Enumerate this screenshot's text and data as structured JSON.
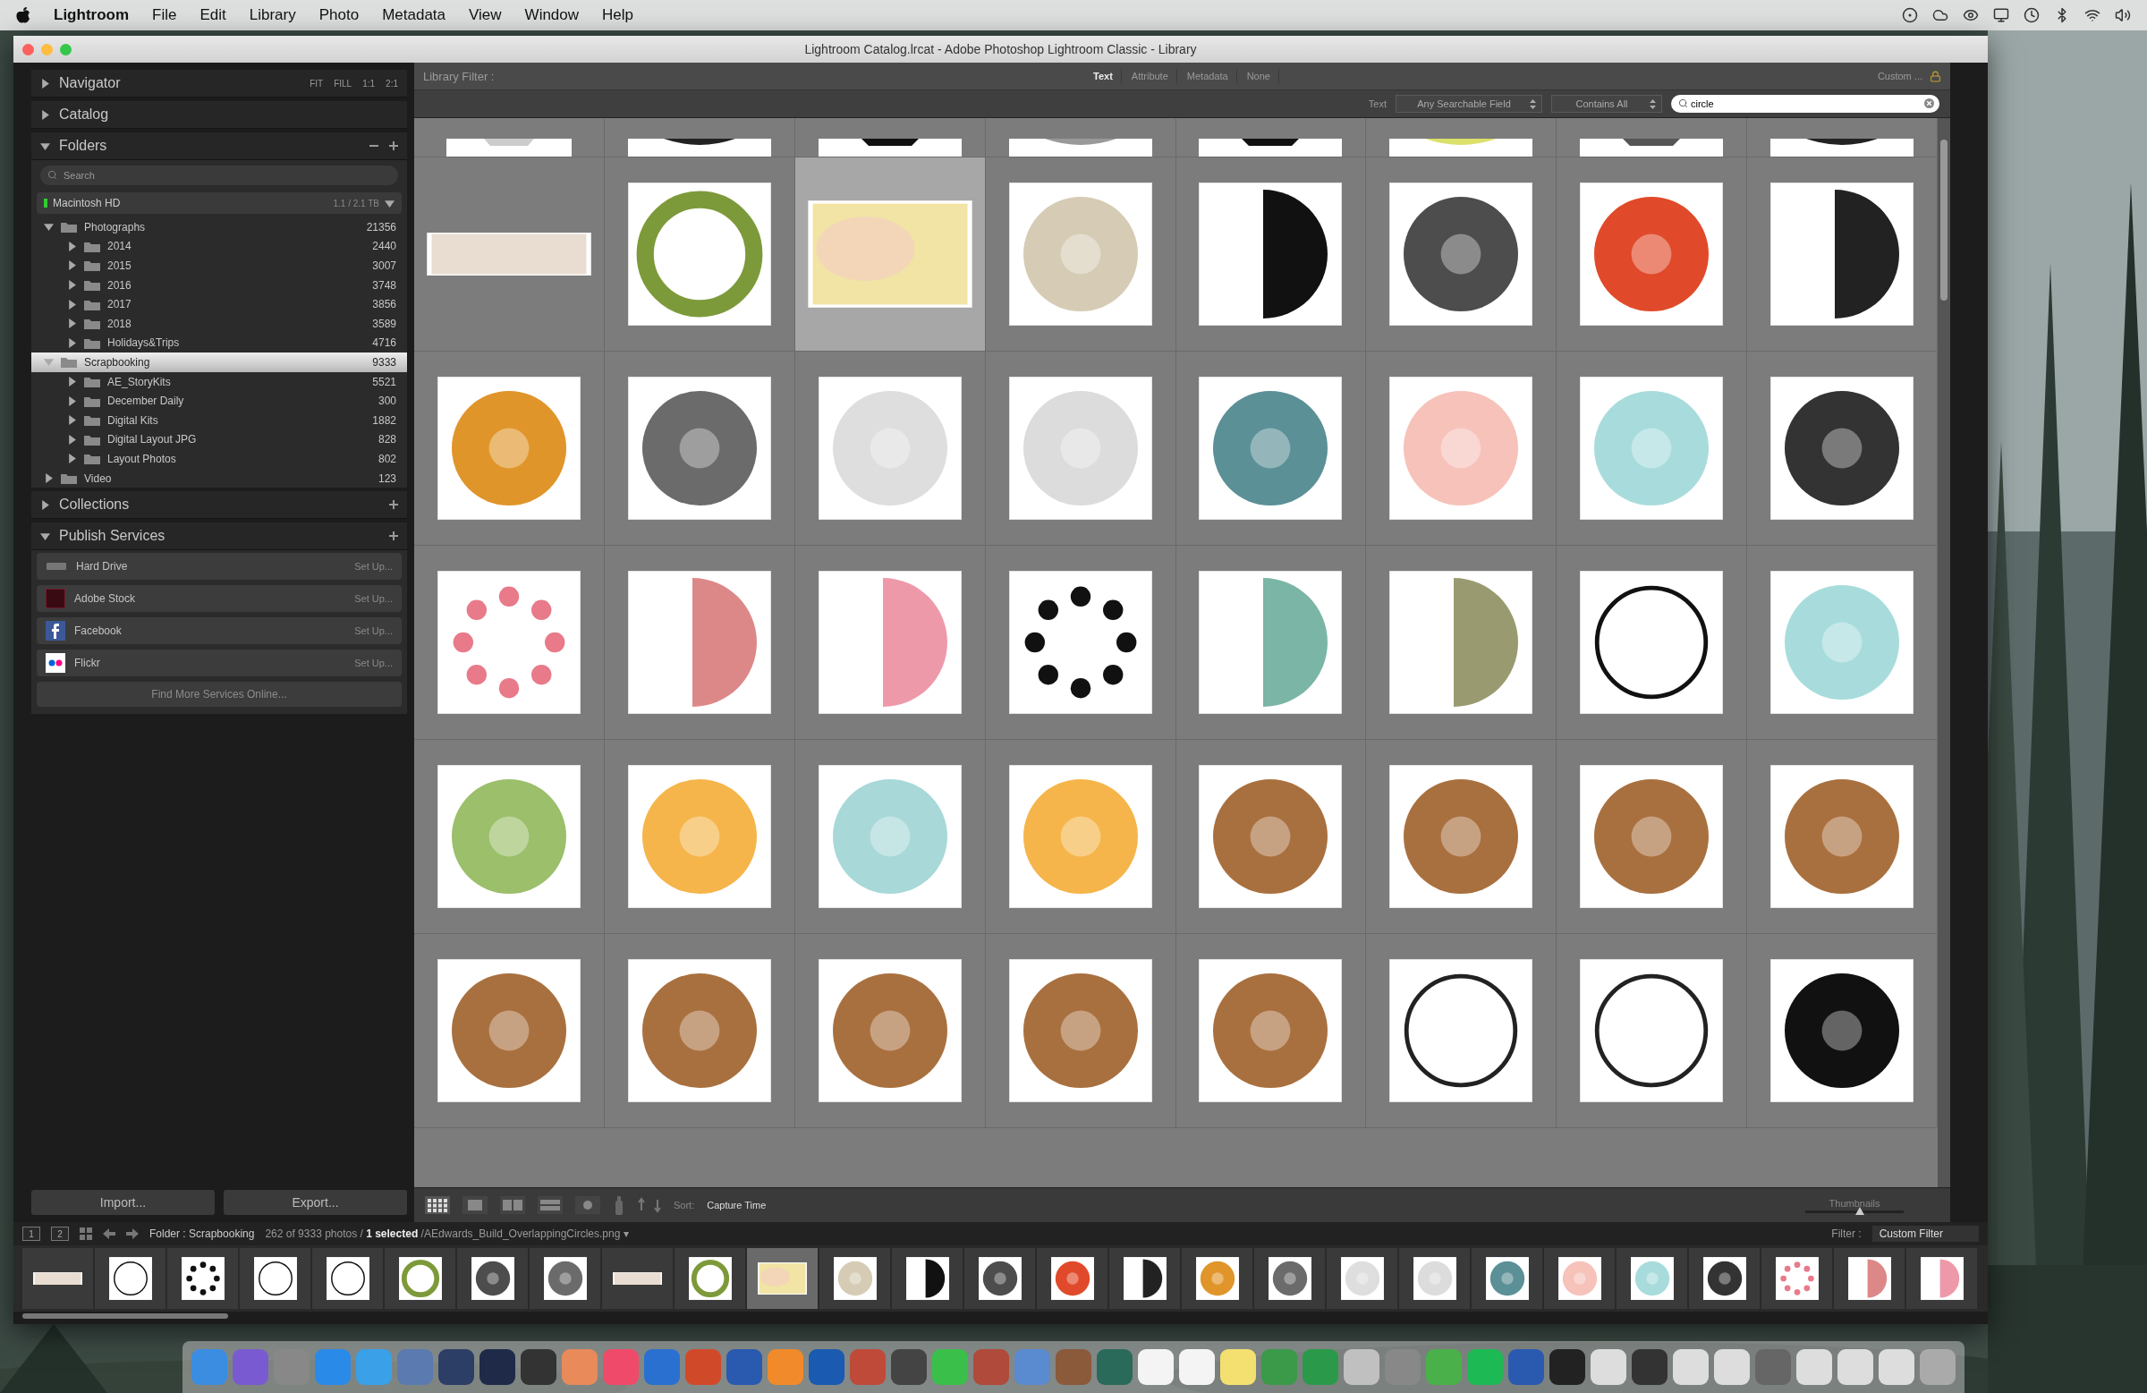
{
  "menu_bar": {
    "app": "Lightroom",
    "menus": [
      "File",
      "Edit",
      "Library",
      "Photo",
      "Metadata",
      "View",
      "Window",
      "Help"
    ]
  },
  "window": {
    "title": "Lightroom Catalog.lrcat - Adobe Photoshop Lightroom Classic - Library"
  },
  "left_panel": {
    "navigator": {
      "title": "Navigator",
      "expanded": false,
      "zoom_options": [
        "FIT",
        "FILL",
        "1:1",
        "2:1"
      ]
    },
    "catalog": {
      "title": "Catalog",
      "expanded": false
    },
    "folders": {
      "title": "Folders",
      "expanded": true,
      "search_placeholder": "Search",
      "volume": {
        "name": "Macintosh HD",
        "space": "1.1 / 2.1 TB"
      },
      "tree": [
        {
          "name": "Photographs",
          "count": "21356",
          "expanded": true,
          "selected": false,
          "children": [
            {
              "name": "2014",
              "count": "2440",
              "expanded": false,
              "selected": false
            },
            {
              "name": "2015",
              "count": "3007",
              "expanded": false,
              "selected": false
            },
            {
              "name": "2016",
              "count": "3748",
              "expanded": false,
              "selected": false
            },
            {
              "name": "2017",
              "count": "3856",
              "expanded": false,
              "selected": false
            },
            {
              "name": "2018",
              "count": "3589",
              "expanded": false,
              "selected": false
            },
            {
              "name": "Holidays&Trips",
              "count": "4716",
              "expanded": false,
              "selected": false
            }
          ]
        },
        {
          "name": "Scrapbooking",
          "count": "9333",
          "expanded": true,
          "selected": true,
          "children": [
            {
              "name": "AE_StoryKits",
              "count": "5521",
              "expanded": false,
              "selected": false
            },
            {
              "name": "December Daily",
              "count": "300",
              "expanded": false,
              "selected": false
            },
            {
              "name": "Digital Kits",
              "count": "1882",
              "expanded": false,
              "selected": false
            },
            {
              "name": "Digital Layout JPG",
              "count": "828",
              "expanded": false,
              "selected": false
            },
            {
              "name": "Layout Photos",
              "count": "802",
              "expanded": false,
              "selected": false
            }
          ]
        },
        {
          "name": "Video",
          "count": "123",
          "expanded": false,
          "selected": false
        }
      ]
    },
    "collections": {
      "title": "Collections",
      "expanded": false
    },
    "publish_services": {
      "title": "Publish Services",
      "expanded": true,
      "services": [
        {
          "kind": "drive",
          "name": "Hard Drive",
          "action": "Set Up..."
        },
        {
          "kind": "stock",
          "name": "Adobe Stock",
          "action": "Set Up..."
        },
        {
          "kind": "facebook",
          "name": "Facebook",
          "action": "Set Up..."
        },
        {
          "kind": "flickr",
          "name": "Flickr",
          "action": "Set Up..."
        }
      ],
      "find_more": "Find More Services Online..."
    },
    "buttons": [
      "Import...",
      "Export..."
    ]
  },
  "library_filter": {
    "label": "Library Filter :",
    "tabs": [
      {
        "label": "Text",
        "selected": true
      },
      {
        "label": "Attribute",
        "selected": false
      },
      {
        "label": "Metadata",
        "selected": false
      },
      {
        "label": "None",
        "selected": false
      }
    ],
    "preset": "Custom ...",
    "locked": true,
    "text_label": "Text",
    "field": "Any Searchable Field",
    "rule": "Contains All",
    "search": "circle"
  },
  "grid": {
    "cut_row": [
      {
        "selected": false
      },
      {
        "selected": false
      },
      {
        "selected": false
      },
      {
        "selected": false
      },
      {
        "selected": false
      },
      {
        "selected": false
      },
      {
        "selected": false
      },
      {
        "selected": false
      }
    ],
    "rows": [
      [
        {
          "selected": false
        },
        {
          "selected": false
        },
        {
          "selected": true
        },
        {
          "selected": false
        },
        {
          "selected": false
        },
        {
          "selected": false
        },
        {
          "selected": false
        },
        {
          "selected": false
        }
      ],
      [
        {
          "selected": false
        },
        {
          "selected": false
        },
        {
          "selected": false
        },
        {
          "selected": false
        },
        {
          "selected": false
        },
        {
          "selected": false
        },
        {
          "selected": false
        },
        {
          "selected": false
        }
      ],
      [
        {
          "selected": false
        },
        {
          "selected": false
        },
        {
          "selected": false
        },
        {
          "selected": false
        },
        {
          "selected": false
        },
        {
          "selected": false
        },
        {
          "selected": false
        },
        {
          "selected": false
        }
      ],
      [
        {
          "selected": false
        },
        {
          "selected": false
        },
        {
          "selected": false
        },
        {
          "selected": false
        },
        {
          "selected": false
        },
        {
          "selected": false
        },
        {
          "selected": false
        },
        {
          "selected": false
        }
      ],
      [
        {
          "selected": false
        },
        {
          "selected": false
        },
        {
          "selected": false
        },
        {
          "selected": false
        },
        {
          "selected": false
        },
        {
          "selected": false
        },
        {
          "selected": false
        },
        {
          "selected": false
        }
      ]
    ]
  },
  "toolbar": {
    "sort_label": "Sort:",
    "sort": "Capture Time",
    "thumbnails_label": "Thumbnails",
    "thumbnail_size": {
      "level": 0.55
    }
  },
  "filmstrip": {
    "pages": [
      "1",
      "2"
    ],
    "source": "Folder : Scrapbooking",
    "info": "262 of 9333 photos / **1 selected** /AEdwards_Build_OverlappingCircles.png ▾",
    "filter_label": "Filter :",
    "filter": "Custom Filter",
    "thumbnails": [
      {
        "selected": false
      },
      {
        "selected": false
      },
      {
        "selected": false
      },
      {
        "selected": false
      },
      {
        "selected": false
      },
      {
        "selected": false
      },
      {
        "selected": false
      },
      {
        "selected": false
      },
      {
        "selected": false
      },
      {
        "selected": false
      },
      {
        "selected": true
      },
      {
        "selected": false
      },
      {
        "selected": false
      },
      {
        "selected": false
      },
      {
        "selected": false
      },
      {
        "selected": false
      },
      {
        "selected": false
      },
      {
        "selected": false
      },
      {
        "selected": false
      },
      {
        "selected": false
      },
      {
        "selected": false
      },
      {
        "selected": false
      },
      {
        "selected": false
      },
      {
        "selected": false
      },
      {
        "selected": false
      },
      {
        "selected": false
      },
      {
        "selected": false
      }
    ]
  }
}
